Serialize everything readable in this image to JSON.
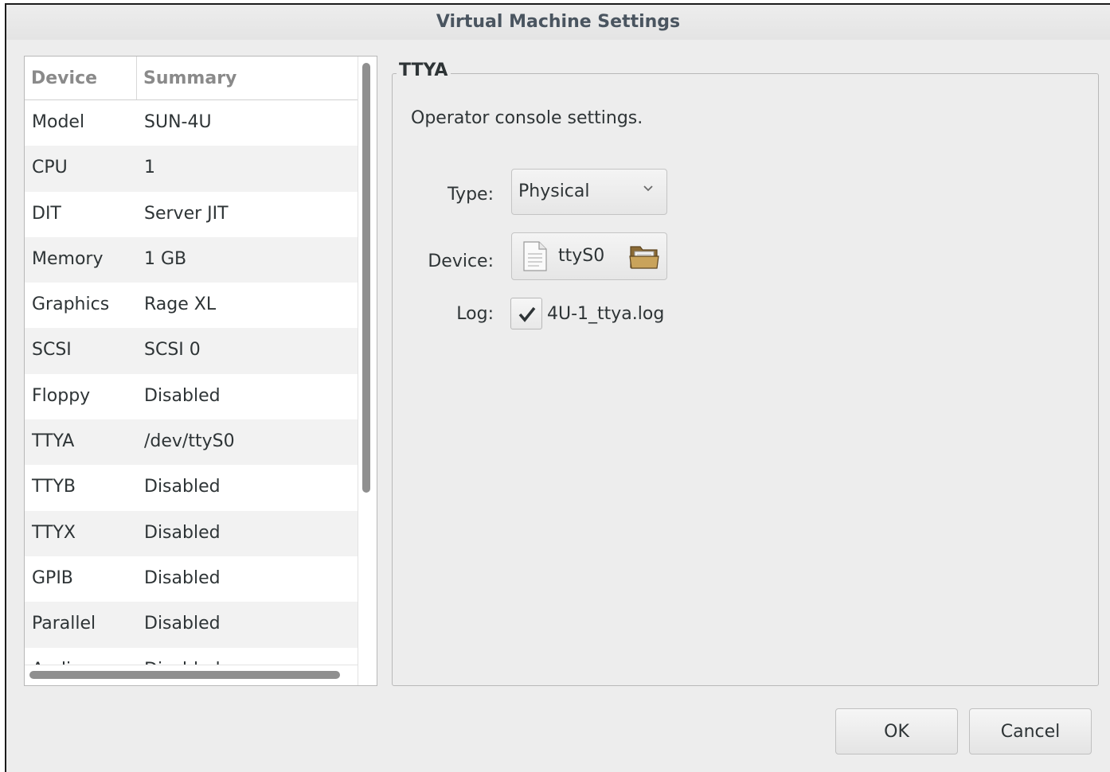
{
  "window": {
    "title": "Virtual Machine Settings"
  },
  "device_list": {
    "columns": {
      "device": "Device",
      "summary": "Summary"
    },
    "rows": [
      {
        "device": "Model",
        "summary": "SUN-4U"
      },
      {
        "device": "CPU",
        "summary": "1"
      },
      {
        "device": "DIT",
        "summary": "Server JIT"
      },
      {
        "device": "Memory",
        "summary": "1 GB"
      },
      {
        "device": "Graphics",
        "summary": "Rage XL"
      },
      {
        "device": "SCSI",
        "summary": "SCSI 0"
      },
      {
        "device": "Floppy",
        "summary": "Disabled"
      },
      {
        "device": "TTYA",
        "summary": "/dev/ttyS0"
      },
      {
        "device": "TTYB",
        "summary": "Disabled"
      },
      {
        "device": "TTYX",
        "summary": "Disabled"
      },
      {
        "device": "GPIB",
        "summary": "Disabled"
      },
      {
        "device": "Parallel",
        "summary": "Disabled"
      },
      {
        "device": "Audio",
        "summary": "Disabled"
      }
    ]
  },
  "settings": {
    "section_title": "TTYA",
    "description": "Operator console settings.",
    "type_label": "Type:",
    "type_value": "Physical",
    "device_label": "Device:",
    "device_value": "ttyS0",
    "log_label": "Log:",
    "log_checked": true,
    "log_value": "4U-1_ttya.log"
  },
  "buttons": {
    "ok": "OK",
    "cancel": "Cancel"
  }
}
